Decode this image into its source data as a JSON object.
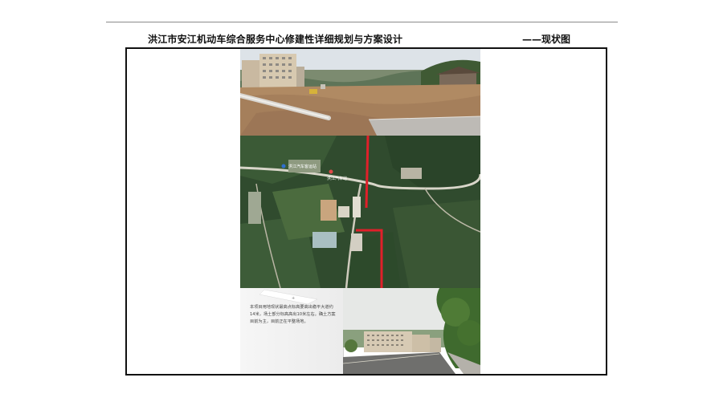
{
  "header": {
    "title": "洪江市安江机动车综合服务中心修建性详细规划与方案设计",
    "subtitle": "——现状图"
  },
  "aerial": {
    "road_labels": [
      "洪江汽车客运站",
      "洪江汽车站"
    ]
  },
  "note": {
    "text": "本项目用地现状最高点标高要高出稳平大道约14米，场土部分标高高出10米左右。确土方案目前为主，目前正在平整场地。"
  },
  "colors": {
    "frame": "#111111",
    "rule": "#8a8a8a",
    "red_boundary": "#e0202a"
  },
  "images": {
    "top_photo": "construction-site-photo",
    "aerial_photo": "satellite-map",
    "street_photo": "street-view-photo"
  }
}
